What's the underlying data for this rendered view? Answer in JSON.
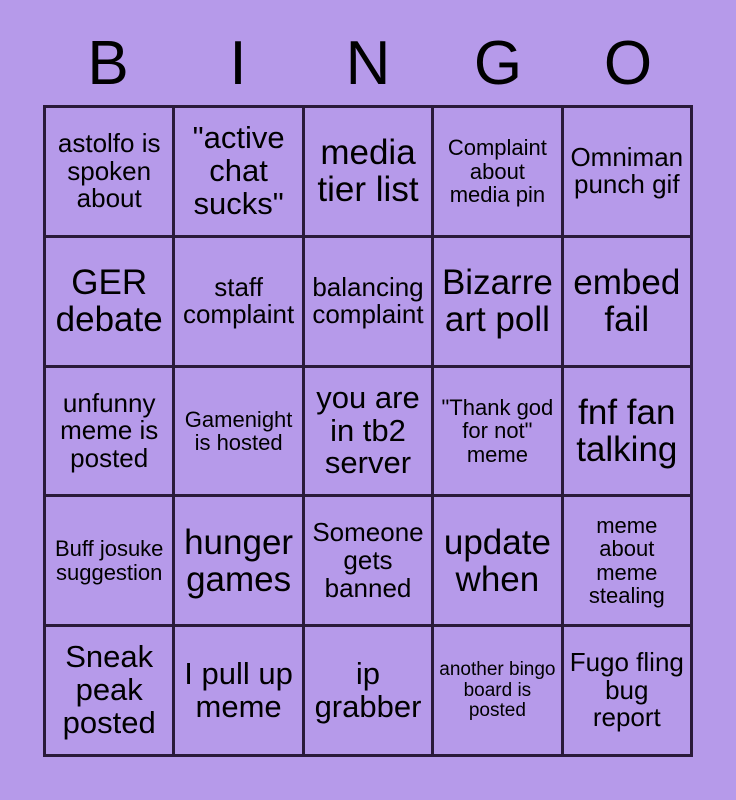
{
  "card": {
    "title": "BINGO",
    "background_color": "#b69aea",
    "cell_color": "#b69aea",
    "grid_line_color": "#2a1a3a",
    "text_color": "#000000",
    "columns": 5,
    "rows": 5
  },
  "header": {
    "letters": [
      "B",
      "I",
      "N",
      "G",
      "O"
    ]
  },
  "cells": [
    {
      "text": "astolfo is spoken about",
      "size": "fs-md"
    },
    {
      "text": "\"active chat sucks\"",
      "size": "fs-lg"
    },
    {
      "text": "media tier list",
      "size": "fs-xl"
    },
    {
      "text": "Complaint about media pin",
      "size": "fs-sm"
    },
    {
      "text": "Omniman punch gif",
      "size": "fs-md"
    },
    {
      "text": "GER debate",
      "size": "fs-xl"
    },
    {
      "text": "staff complaint",
      "size": "fs-md"
    },
    {
      "text": "balancing complaint",
      "size": "fs-md"
    },
    {
      "text": "Bizarre art poll",
      "size": "fs-xl"
    },
    {
      "text": "embed fail",
      "size": "fs-xl"
    },
    {
      "text": "unfunny meme is posted",
      "size": "fs-md"
    },
    {
      "text": "Gamenight is hosted",
      "size": "fs-sm"
    },
    {
      "text": "you are in tb2 server",
      "size": "fs-lg"
    },
    {
      "text": "\"Thank god for not\" meme",
      "size": "fs-sm"
    },
    {
      "text": "fnf fan talking",
      "size": "fs-xl"
    },
    {
      "text": "Buff josuke suggestion",
      "size": "fs-sm"
    },
    {
      "text": "hunger games",
      "size": "fs-xl"
    },
    {
      "text": "Someone gets banned",
      "size": "fs-md"
    },
    {
      "text": "update when",
      "size": "fs-xl"
    },
    {
      "text": "meme about meme stealing",
      "size": "fs-sm"
    },
    {
      "text": "Sneak peak posted",
      "size": "fs-lg"
    },
    {
      "text": "I pull up meme",
      "size": "fs-lg"
    },
    {
      "text": "ip grabber",
      "size": "fs-lg"
    },
    {
      "text": "another bingo board is posted",
      "size": "fs-xs"
    },
    {
      "text": "Fugo fling bug report",
      "size": "fs-md"
    }
  ]
}
